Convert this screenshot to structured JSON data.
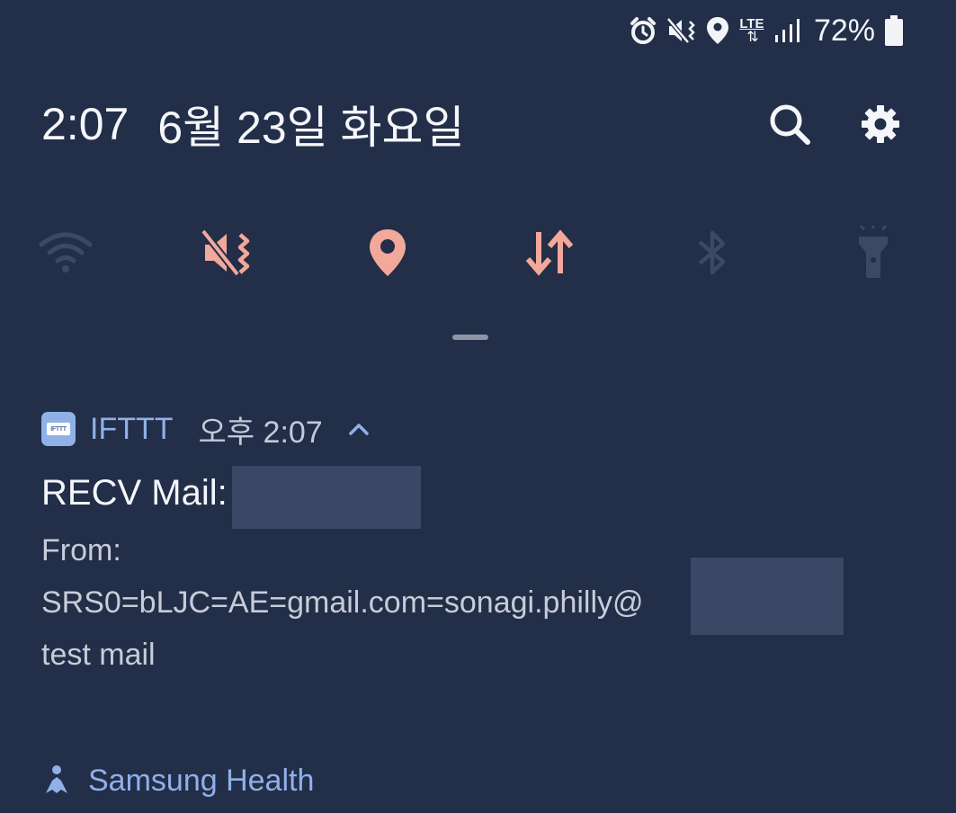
{
  "status_bar": {
    "icons": [
      "alarm-icon",
      "vibrate-icon",
      "location-icon",
      "lte-icon",
      "signal-icon",
      "battery-icon"
    ],
    "network_label": "LTE",
    "battery_percent": "72%"
  },
  "header": {
    "time": "2:07",
    "date": "6월 23일 화요일",
    "search_icon": "search-icon",
    "settings_icon": "gear-icon"
  },
  "quick_toggles": [
    {
      "name": "wifi",
      "icon": "wifi-icon",
      "active": false
    },
    {
      "name": "vibrate",
      "icon": "vibrate-icon",
      "active": true
    },
    {
      "name": "location",
      "icon": "location-icon",
      "active": true
    },
    {
      "name": "mobile-data",
      "icon": "mobile-data-icon",
      "active": true
    },
    {
      "name": "bluetooth",
      "icon": "bluetooth-icon",
      "active": false
    },
    {
      "name": "flashlight",
      "icon": "flashlight-icon",
      "active": false
    }
  ],
  "colors": {
    "background": "#232e49",
    "active_toggle": "#f2a89a",
    "inactive_toggle": "#3d4963",
    "app_accent": "#8fb1e8"
  },
  "notification": {
    "app_name": "IFTTT",
    "app_icon_text": "IFTTT",
    "time": "오후 2:07",
    "title": "RECV Mail:",
    "body_line1": "From:",
    "body_line2": "SRS0=bLJC=AE=gmail.com=sonagi.philly@",
    "body_line3": "test mail"
  },
  "next_notification": {
    "app_name": "Samsung Health",
    "icon": "samsung-health-icon"
  }
}
